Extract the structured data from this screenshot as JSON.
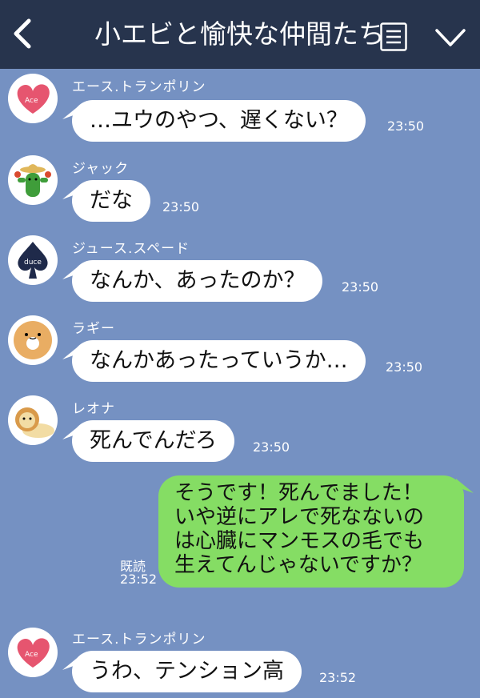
{
  "header": {
    "title": "小エビと愉快な仲間たち",
    "background": "#27344d",
    "icons": [
      "back-arrow-icon",
      "menu-icon",
      "chevron-down-icon"
    ]
  },
  "colors": {
    "background": "#7591c2",
    "incoming_bubble": "#ffffff",
    "outgoing_bubble": "#85dd64"
  },
  "messages": [
    {
      "sender": "エース.トランポリン",
      "text": "…ユウのやつ、遅くない？",
      "time": "23:50",
      "avatar": "heart-avatar-icon"
    },
    {
      "sender": "ジャック",
      "text": "だな",
      "time": "23:50",
      "avatar": "cactus-avatar-icon"
    },
    {
      "sender": "ジュース.スペード",
      "text": "なんか、あったのか？",
      "time": "23:50",
      "avatar": "spade-avatar-icon"
    },
    {
      "sender": "ラギー",
      "text": "なんかあったっていうか…",
      "time": "23:50",
      "avatar": "donut-avatar-icon"
    },
    {
      "sender": "レオナ",
      "text": "死んでんだろ",
      "time": "23:50",
      "avatar": "lion-avatar-icon"
    }
  ],
  "my_message": {
    "lines": [
      "そうです！死んでました！",
      "いや逆にアレで死なないの",
      "は心臓にマンモスの毛でも",
      "生えてんじゃないですか？"
    ],
    "read_label": "既読",
    "time": "23:52"
  },
  "last_message": {
    "sender": "エース.トランポリン",
    "text": "うわ、テンション高",
    "time": "23:52",
    "avatar": "heart-avatar-icon"
  },
  "avatar_text": {
    "ace": "Ace",
    "deuce": "duce"
  }
}
